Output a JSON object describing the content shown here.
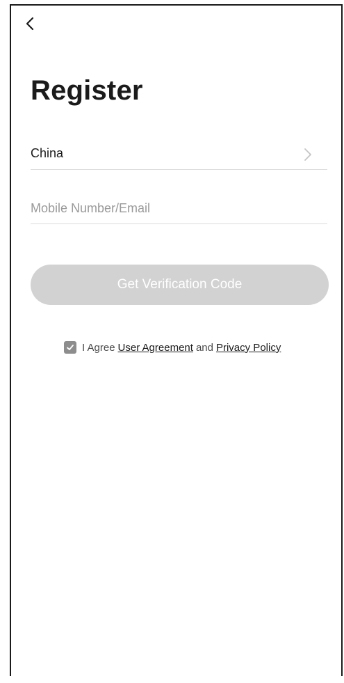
{
  "header": {
    "back_icon": "chevron-left-icon",
    "title": "Register"
  },
  "form": {
    "country": {
      "value": "China",
      "icon": "chevron-right-icon"
    },
    "account": {
      "placeholder": "Mobile Number/Email",
      "value": ""
    },
    "submit_label": "Get Verification Code",
    "submit_enabled": false
  },
  "agreement": {
    "checked": true,
    "prefix": "I Agree",
    "user_agreement_link": "User Agreement",
    "conjunction": "and",
    "privacy_policy_link": "Privacy Policy"
  },
  "colors": {
    "button_disabled": "#d2d2d2",
    "checkbox": "#8d8d8d",
    "text_primary": "#1b1b1b",
    "placeholder": "#9a9a9a",
    "divider": "#dcdcdc"
  }
}
